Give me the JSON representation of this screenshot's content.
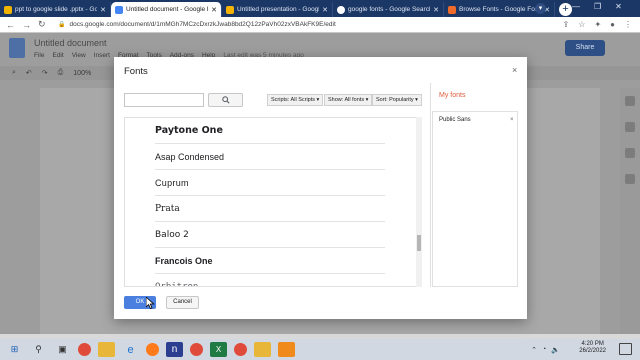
{
  "browser": {
    "tabs": [
      {
        "title": "ppt to google slide .pptx - Go",
        "color": "#f0b400"
      },
      {
        "title": "Untitled document - Google D",
        "color": "#4285f4"
      },
      {
        "title": "Untitled presentation - Googl",
        "color": "#f4b400"
      },
      {
        "title": "google fonts - Google Search",
        "color": "#ffffff"
      },
      {
        "title": "Browse Fonts - Google Fonts",
        "color": "#f06a2a"
      }
    ],
    "url": "docs.google.com/document/d/1mMGh7MCzcDxrzkJwab8bd2Q12zPaVh02zxVBAkFK9E/edit"
  },
  "docs": {
    "title": "Untitled document",
    "menu": [
      "File",
      "Edit",
      "View",
      "Insert",
      "Format",
      "Tools",
      "Add-ons",
      "Help"
    ],
    "last_edit": "Last edit was 5 minutes ago",
    "share_label": "Share",
    "zoom": "100%"
  },
  "modal": {
    "title": "Fonts",
    "close": "×",
    "search_icon": "search-icon",
    "filters": {
      "scripts": "Scripts: All Scripts ▾",
      "show": "Show: All fonts ▾",
      "sort": "Sort: Popularity ▾"
    },
    "fonts": [
      {
        "name": "Paytone One"
      },
      {
        "name": "Asap Condensed"
      },
      {
        "name": "Cuprum"
      },
      {
        "name": "Prata"
      },
      {
        "name": "Baloo 2"
      },
      {
        "name": "Francois One"
      },
      {
        "name": "Orbitron"
      }
    ],
    "scroll_position": 0.68,
    "my_fonts": {
      "title": "My fonts",
      "items": [
        {
          "name": "Public Sans",
          "remove": "×"
        }
      ]
    },
    "ok_label": "OK",
    "cancel_label": "Cancel"
  },
  "taskbar": {
    "time": "4:20 PM",
    "date": "26/2/2022",
    "apps": [
      "windows-icon",
      "search-icon",
      "task-view-icon",
      "chrome-icon",
      "file-explorer-icon",
      "edge-icon",
      "firefox-icon",
      "notion-icon",
      "chrome-icon",
      "excel-icon",
      "chrome-icon",
      "folder-icon",
      "slides-icon"
    ]
  },
  "colors": {
    "accent": "#4a7fe0",
    "myfonts_title": "#dd5a3a",
    "tabstrip": "#1a3766"
  }
}
